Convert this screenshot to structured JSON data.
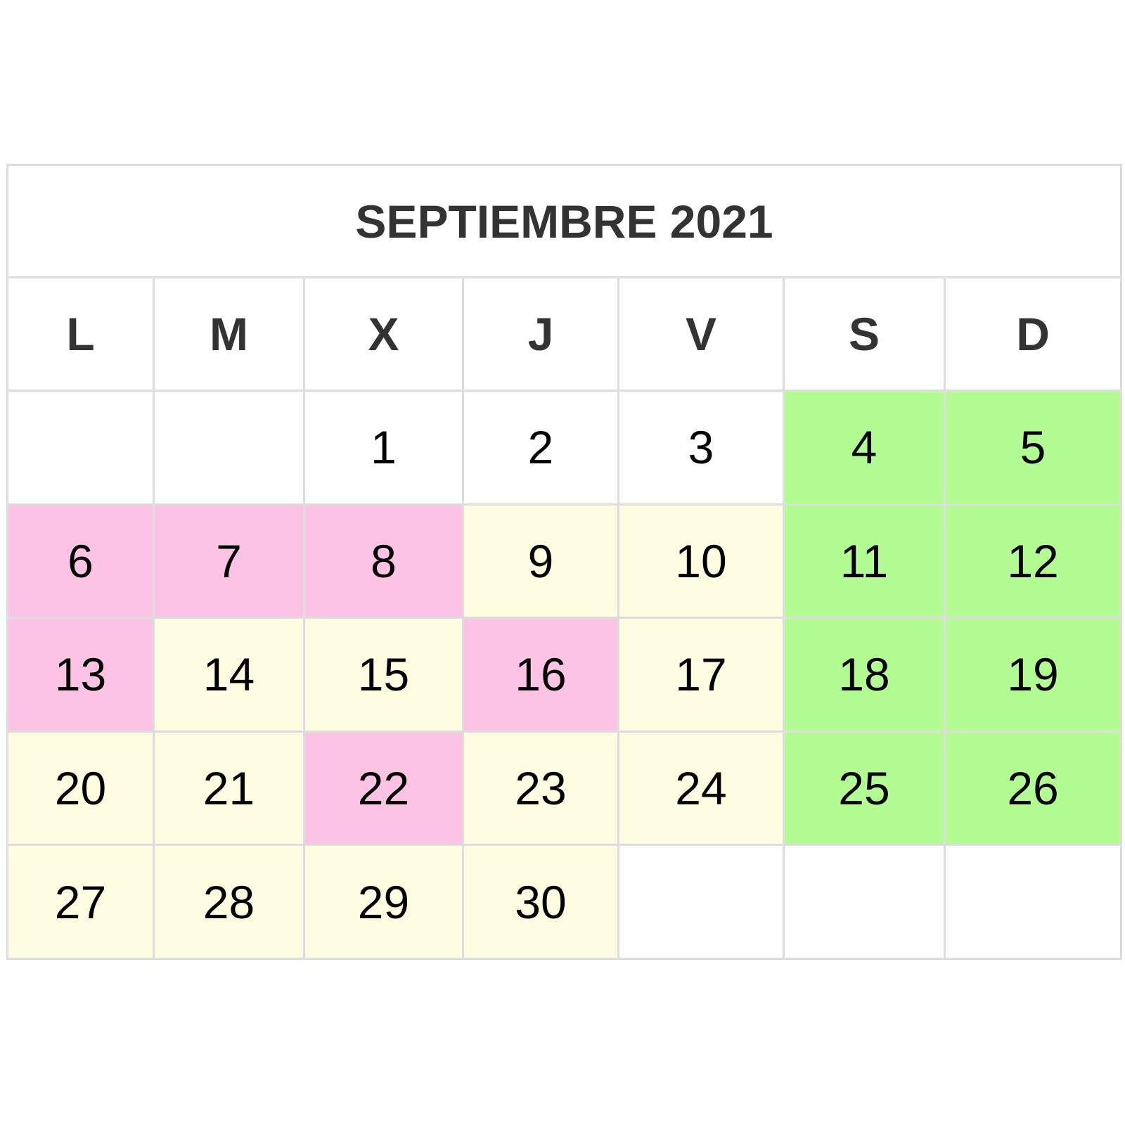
{
  "calendar": {
    "title": "SEPTIEMBRE 2021",
    "weekdays": [
      "L",
      "M",
      "X",
      "J",
      "V",
      "S",
      "D"
    ],
    "colors": {
      "empty": "#ffffff",
      "weekend": "#b3fc93",
      "pink": "#fdc3e5",
      "yellow": "#fefde2"
    },
    "weeks": [
      [
        {
          "day": "",
          "status": "empty"
        },
        {
          "day": "",
          "status": "empty"
        },
        {
          "day": "1",
          "status": "empty"
        },
        {
          "day": "2",
          "status": "empty"
        },
        {
          "day": "3",
          "status": "empty"
        },
        {
          "day": "4",
          "status": "weekend"
        },
        {
          "day": "5",
          "status": "weekend"
        }
      ],
      [
        {
          "day": "6",
          "status": "pink"
        },
        {
          "day": "7",
          "status": "pink"
        },
        {
          "day": "8",
          "status": "pink"
        },
        {
          "day": "9",
          "status": "yellow"
        },
        {
          "day": "10",
          "status": "yellow"
        },
        {
          "day": "11",
          "status": "weekend"
        },
        {
          "day": "12",
          "status": "weekend"
        }
      ],
      [
        {
          "day": "13",
          "status": "pink"
        },
        {
          "day": "14",
          "status": "yellow"
        },
        {
          "day": "15",
          "status": "yellow"
        },
        {
          "day": "16",
          "status": "pink"
        },
        {
          "day": "17",
          "status": "yellow"
        },
        {
          "day": "18",
          "status": "weekend"
        },
        {
          "day": "19",
          "status": "weekend"
        }
      ],
      [
        {
          "day": "20",
          "status": "yellow"
        },
        {
          "day": "21",
          "status": "yellow"
        },
        {
          "day": "22",
          "status": "pink"
        },
        {
          "day": "23",
          "status": "yellow"
        },
        {
          "day": "24",
          "status": "yellow"
        },
        {
          "day": "25",
          "status": "weekend"
        },
        {
          "day": "26",
          "status": "weekend"
        }
      ],
      [
        {
          "day": "27",
          "status": "yellow"
        },
        {
          "day": "28",
          "status": "yellow"
        },
        {
          "day": "29",
          "status": "yellow"
        },
        {
          "day": "30",
          "status": "yellow"
        },
        {
          "day": "",
          "status": "empty"
        },
        {
          "day": "",
          "status": "empty"
        },
        {
          "day": "",
          "status": "empty"
        }
      ]
    ]
  }
}
